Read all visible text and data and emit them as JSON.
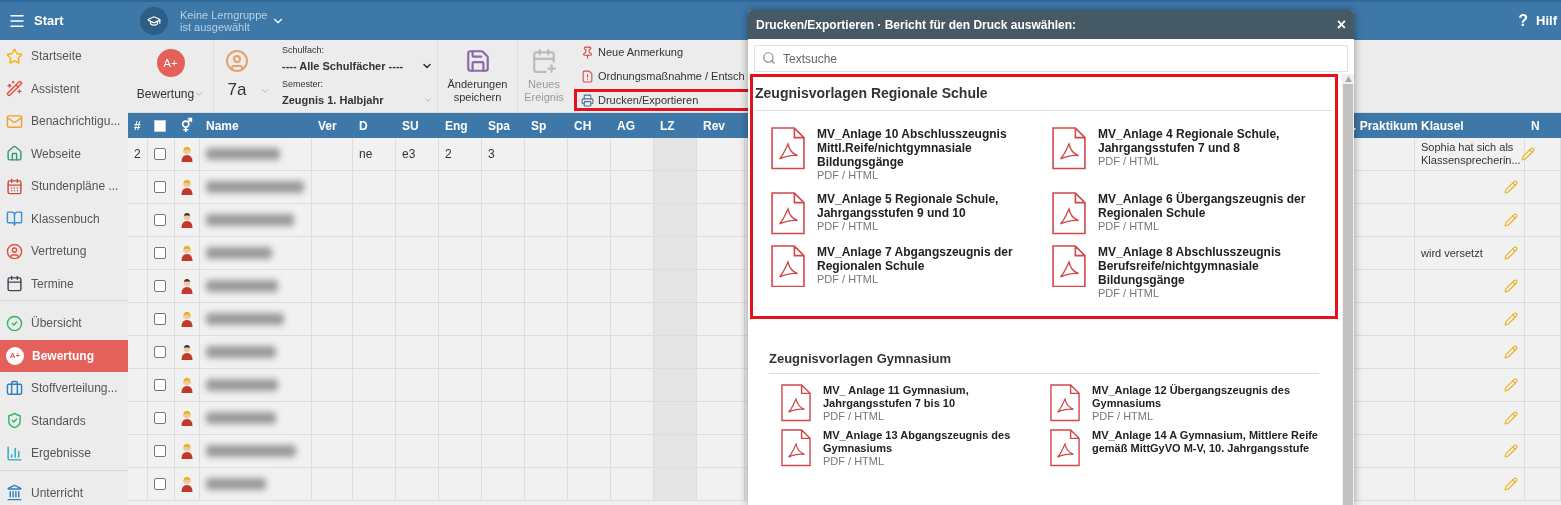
{
  "topbar": {
    "menu_label": "Start",
    "group_line1": "Keine Lerngruppe",
    "group_line2": "ist ausgewählt",
    "help_symbol": "?",
    "help_label": "Hilf"
  },
  "sidebar": {
    "groups": [
      [
        {
          "label": "Startseite",
          "selected": false
        },
        {
          "label": "Assistent",
          "selected": false
        },
        {
          "label": "Benachrichtigu...",
          "selected": false
        },
        {
          "label": "Webseite",
          "selected": false
        },
        {
          "label": "Stundenpläne ...",
          "selected": false
        },
        {
          "label": "Klassenbuch",
          "selected": false
        },
        {
          "label": "Vertretung",
          "selected": false
        },
        {
          "label": "Termine",
          "selected": false
        }
      ],
      [
        {
          "label": "Übersicht",
          "selected": false
        },
        {
          "label": "Bewertung",
          "selected": true,
          "icon_text": "A+"
        },
        {
          "label": "Stoffverteilung...",
          "selected": false
        },
        {
          "label": "Standards",
          "selected": false
        },
        {
          "label": "Ergebnisse",
          "selected": false
        }
      ],
      [
        {
          "label": "Unterricht",
          "selected": false
        }
      ]
    ]
  },
  "toolbar": {
    "mode_icon_text": "A+",
    "mode_button": "Bewertung",
    "group": "7a",
    "subject_label": "Schulfach:",
    "subject_value": "---- Alle Schulfächer ----",
    "semester_label": "Semester:",
    "semester_value": "Zeugnis 1. Halbjahr",
    "save_button": "Änderungen speichern",
    "event_button": "Neues Ereignis",
    "event_disabled": true,
    "actions": [
      {
        "label": "Neue Anmerkung",
        "highlighted": false
      },
      {
        "label": "Ordnungsmaßnahme / Entsch",
        "highlighted": false
      },
      {
        "label": "Drucken/Exportieren",
        "highlighted": true
      }
    ]
  },
  "table": {
    "header_checkbox_checked": false,
    "columns": [
      {
        "label": "#",
        "kind": "text"
      },
      {
        "kind": "checkbox"
      },
      {
        "label": "⚥",
        "kind": "gender"
      },
      {
        "label": "Name",
        "kind": "name"
      },
      {
        "label": "Ver",
        "kind": "text"
      },
      {
        "label": "D",
        "kind": "text"
      },
      {
        "label": "SU",
        "kind": "text"
      },
      {
        "label": "Eng",
        "kind": "text"
      },
      {
        "label": "Spa",
        "kind": "text"
      },
      {
        "label": "Sp",
        "kind": "text"
      },
      {
        "label": "CH",
        "kind": "text"
      },
      {
        "label": "AG",
        "kind": "text"
      },
      {
        "label": "LZ",
        "kind": "text"
      },
      {
        "label": "Rev",
        "kind": "text"
      }
    ],
    "right_columns": [
      {
        "label": ". Praktikum",
        "kind": "text"
      },
      {
        "label": "Klausel",
        "kind": "note"
      },
      {
        "label": "N",
        "kind": "text"
      }
    ],
    "rows": [
      {
        "checked": false,
        "kind": "female",
        "cells": [
          "2",
          null,
          null,
          null,
          null,
          "ne",
          "e3",
          "2",
          "3",
          null,
          null,
          null,
          null,
          null
        ],
        "right_cells": [
          null,
          "Sophia hat sich als Klassensprecherin...",
          null
        ]
      },
      {
        "checked": false,
        "kind": "female"
      },
      {
        "checked": false,
        "kind": "male"
      },
      {
        "checked": false,
        "kind": "female",
        "right_cells": [
          null,
          "wird versetzt",
          null
        ]
      },
      {
        "checked": false,
        "kind": "male"
      },
      {
        "checked": false,
        "kind": "female"
      },
      {
        "checked": false,
        "kind": "male"
      },
      {
        "checked": false,
        "kind": "female"
      },
      {
        "checked": false,
        "kind": "female"
      },
      {
        "checked": false,
        "kind": "female"
      },
      {
        "checked": false,
        "kind": "female"
      }
    ]
  },
  "dialog": {
    "title": "Drucken/Exportieren · Bericht für den Druck auswählen:",
    "close": "×",
    "search_placeholder": "Textsuche",
    "sections": [
      {
        "title": "Zeugnisvorlagen Regionale Schule",
        "highlighted": true,
        "items": [
          {
            "title": "MV_Anlage 10 Abschlusszeugnis Mittl.Reife/nichtgymnasiale Bildungsgänge",
            "format": "PDF / HTML"
          },
          {
            "title": "MV_Anlage 4 Regionale Schule, Jahrgangsstufen 7 und 8",
            "format": "PDF / HTML"
          },
          {
            "title": "MV_Anlage 5 Regionale Schule, Jahrgangsstufen 9 und 10",
            "format": "PDF / HTML"
          },
          {
            "title": "MV_Anlage 6 Übergangszeugnis der Regionalen Schule",
            "format": "PDF / HTML"
          },
          {
            "title": "MV_Anlage 7 Abgangszeugnis der Regionalen Schule",
            "format": "PDF / HTML"
          },
          {
            "title": "MV_Anlage 8 Abschlusszeugnis Berufsreife/nichtgymnasiale Bildungsgänge",
            "format": "PDF / HTML"
          }
        ]
      },
      {
        "title": "Zeugnisvorlagen Gymnasium",
        "highlighted": false,
        "items": [
          {
            "title": "MV_ Anlage 11 Gymnasium, Jahrgangsstufen 7 bis 10",
            "format": "PDF / HTML"
          },
          {
            "title": "MV_Anlage 12 Übergangszeugnis des Gymnasiums",
            "format": "PDF / HTML"
          },
          {
            "title": "MV_Anlage 13 Abgangszeugnis des Gymnasiums",
            "format": "PDF / HTML"
          },
          {
            "title": "MV_Anlage 14 A Gymnasium, Mittlere Reife gemäß MittGyVO M-V, 10. Jahrgangsstufe"
          }
        ]
      }
    ]
  }
}
